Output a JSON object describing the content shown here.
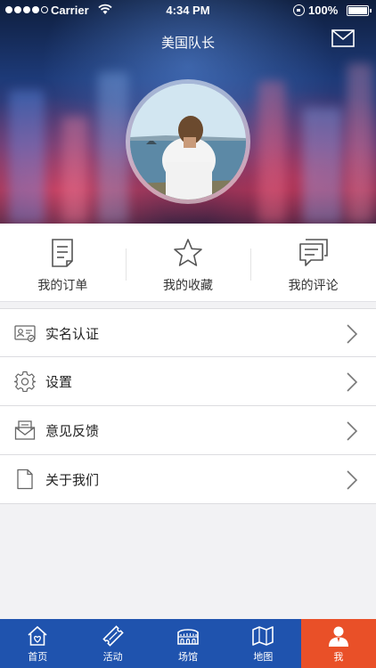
{
  "status_bar": {
    "carrier": "Carrier",
    "time": "4:34 PM",
    "battery": "100%"
  },
  "header": {
    "title": "美国队长",
    "mail_icon": "mail-icon"
  },
  "quick_actions": [
    {
      "label": "我的订单",
      "icon": "order-document-icon"
    },
    {
      "label": "我的收藏",
      "icon": "star-icon"
    },
    {
      "label": "我的评论",
      "icon": "comment-icon"
    }
  ],
  "menu": [
    {
      "label": "实名认证",
      "icon": "id-card-icon"
    },
    {
      "label": "设置",
      "icon": "gear-icon"
    },
    {
      "label": "意见反馈",
      "icon": "feedback-envelope-icon"
    },
    {
      "label": "关于我们",
      "icon": "document-icon"
    }
  ],
  "tabbar": [
    {
      "label": "首页",
      "icon": "home-icon",
      "active": false
    },
    {
      "label": "活动",
      "icon": "ticket-icon",
      "active": false
    },
    {
      "label": "场馆",
      "icon": "colosseum-icon",
      "active": false
    },
    {
      "label": "地图",
      "icon": "map-icon",
      "active": false
    },
    {
      "label": "我",
      "icon": "user-icon",
      "active": true
    }
  ],
  "colors": {
    "tabbar_bg": "#1f53ae",
    "tab_active": "#e95028",
    "page_bg": "#f2f2f4"
  }
}
